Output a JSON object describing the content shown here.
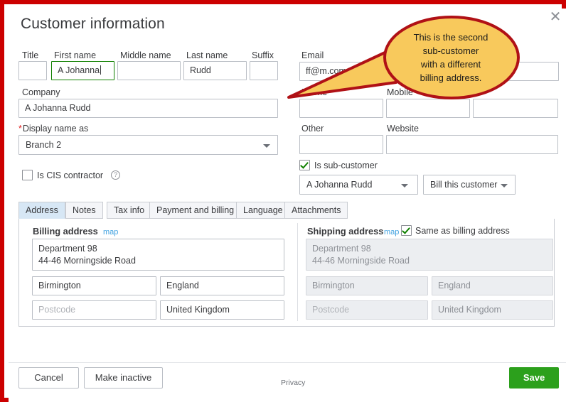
{
  "window": {
    "title": "Customer information",
    "close_icon": "close-icon",
    "frame_color": "#cc0000"
  },
  "annotation": {
    "text": "This is the second\nsub-customer\nwith a different\nbilling address.",
    "fill_color": "#f8c95c",
    "border_color": "#b01116"
  },
  "name_row": {
    "fields": [
      {
        "label": "Title",
        "value": "",
        "focused": false
      },
      {
        "label": "First name",
        "value": "A Johanna",
        "focused": true
      },
      {
        "label": "Middle name",
        "value": "",
        "focused": false
      },
      {
        "label": "Last name",
        "value": "Rudd",
        "focused": false
      },
      {
        "label": "Suffix",
        "value": "",
        "focused": false
      }
    ]
  },
  "company": {
    "label": "Company",
    "value": "A Johanna Rudd"
  },
  "display_name": {
    "label": "Display name as",
    "required_marker": "*",
    "value": "Branch 2",
    "caret_icon": "chevron-down-icon"
  },
  "cis": {
    "label": "Is CIS contractor",
    "checked": false,
    "help_icon": "help-question-icon",
    "help_glyph": "?"
  },
  "contact": {
    "email": {
      "label": "Email",
      "value": "ff@m.com"
    },
    "phone": {
      "label": "Phone",
      "value": ""
    },
    "mobile": {
      "label": "Mobile",
      "value": ""
    },
    "fax": {
      "label": "",
      "value": ""
    },
    "other": {
      "label": "Other",
      "value": ""
    },
    "website": {
      "label": "Website",
      "value": ""
    }
  },
  "sub_customer": {
    "label": "Is sub-customer",
    "checked": true,
    "parent": {
      "value": "A Johanna Rudd",
      "caret_icon": "chevron-down-icon"
    },
    "billing_mode": {
      "value": "Bill this customer",
      "caret_icon": "chevron-down-icon"
    }
  },
  "tabs": [
    {
      "label": "Address",
      "active": true
    },
    {
      "label": "Notes",
      "active": false
    },
    {
      "label": "Tax info",
      "active": false
    },
    {
      "label": "Payment and billing",
      "active": false
    },
    {
      "label": "Language",
      "active": false
    },
    {
      "label": "Attachments",
      "active": false
    }
  ],
  "billing_address": {
    "title": "Billing address",
    "map_link": "map",
    "street": "Department 98\n44-46 Morningside Road",
    "city": "Birmington",
    "county": "England",
    "postcode": "",
    "postcode_placeholder": "Postcode",
    "country": "United Kingdom"
  },
  "shipping_address": {
    "title": "Shipping address",
    "map_link": "map",
    "same_as_billing_label": "Same as billing address",
    "same_as_billing_checked": true,
    "street": "Department 98\n44-46 Morningside Road",
    "city": "Birmington",
    "county": "England",
    "postcode": "",
    "postcode_placeholder": "Postcode",
    "country": "United Kingdom"
  },
  "footer": {
    "cancel_label": "Cancel",
    "make_inactive_label": "Make inactive",
    "privacy_label": "Privacy",
    "save_label": "Save",
    "save_color": "#2ca01c"
  }
}
